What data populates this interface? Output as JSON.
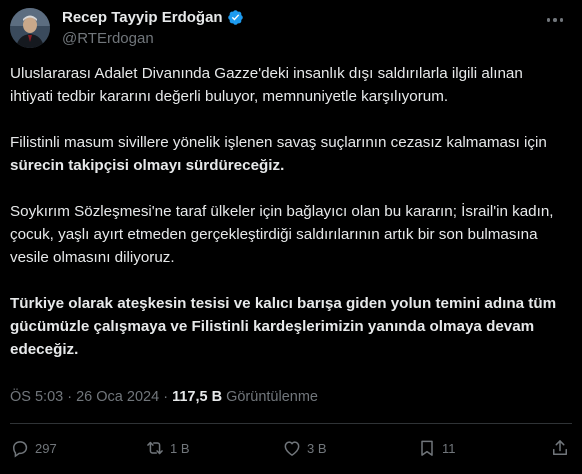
{
  "author": {
    "display_name": "Recep Tayyip Erdoğan",
    "handle": "@RTErdogan"
  },
  "tweet": {
    "paragraphs": [
      {
        "segments": [
          {
            "text": "Uluslararası Adalet Divanında Gazze'deki insanlık dışı saldırılarla ilgili alınan ihtiyati tedbir kararını değerli buluyor, memnuniyetle karşılıyorum.",
            "bold": false
          }
        ]
      },
      {
        "segments": [
          {
            "text": "Filistinli masum sivillere yönelik işlenen savaş suçlarının cezasız kalmaması için ",
            "bold": false
          },
          {
            "text": "sürecin takipçisi olmayı sürdüreceğiz.",
            "bold": true
          }
        ]
      },
      {
        "segments": [
          {
            "text": "Soykırım Sözleşmesi'ne taraf ülkeler için bağlayıcı olan bu kararın; İsrail'in kadın, çocuk, yaşlı ayırt etmeden gerçekleştirdiği saldırılarının artık bir son bulmasına vesile olmasını diliyoruz.",
            "bold": false
          }
        ]
      },
      {
        "segments": [
          {
            "text": "Türkiye olarak ateşkesin tesisi ve kalıcı barışa giden yolun temini adına tüm gücümüzle çalışmaya ve Filistinli kardeşlerimizin yanında olmaya devam edeceğiz.",
            "bold": true
          }
        ]
      }
    ],
    "time": "ÖS 5:03",
    "separator": "·",
    "date": "26 Oca 2024",
    "views_count": "117,5 B",
    "views_label": "Görüntülenme"
  },
  "actions": {
    "replies": "297",
    "retweets": "1 B",
    "likes": "3 B",
    "bookmarks": "11"
  },
  "icons": {
    "verified": "verified-badge-icon",
    "more": "more-dots-icon",
    "reply": "reply-bubble-icon",
    "retweet": "retweet-icon",
    "like": "heart-icon",
    "bookmark": "bookmark-icon",
    "share": "share-upload-icon"
  },
  "colors": {
    "background": "#000000",
    "text": "#e7e9ea",
    "muted": "#71767b",
    "verified_blue": "#1d9bf0",
    "divider": "#2f3336"
  }
}
